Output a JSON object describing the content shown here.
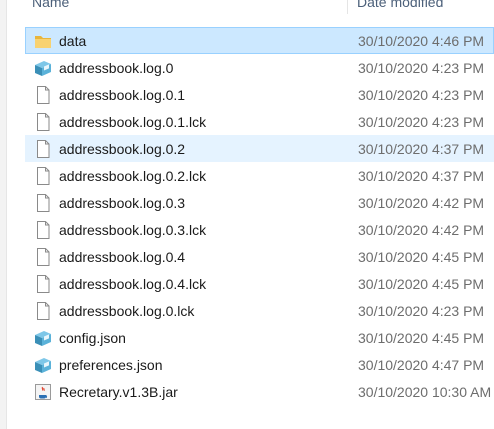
{
  "header": {
    "name_label": "Name",
    "date_label": "Date modified"
  },
  "files": [
    {
      "name": "data",
      "date": "30/10/2020 4:46 PM",
      "icon": "folder-icon",
      "state": "selected"
    },
    {
      "name": "addressbook.log.0",
      "date": "30/10/2020 4:23 PM",
      "icon": "app-file-icon",
      "state": ""
    },
    {
      "name": "addressbook.log.0.1",
      "date": "30/10/2020 4:23 PM",
      "icon": "blank-file-icon",
      "state": ""
    },
    {
      "name": "addressbook.log.0.1.lck",
      "date": "30/10/2020 4:23 PM",
      "icon": "blank-file-icon",
      "state": ""
    },
    {
      "name": "addressbook.log.0.2",
      "date": "30/10/2020 4:37 PM",
      "icon": "blank-file-icon",
      "state": "hover"
    },
    {
      "name": "addressbook.log.0.2.lck",
      "date": "30/10/2020 4:37 PM",
      "icon": "blank-file-icon",
      "state": ""
    },
    {
      "name": "addressbook.log.0.3",
      "date": "30/10/2020 4:42 PM",
      "icon": "blank-file-icon",
      "state": ""
    },
    {
      "name": "addressbook.log.0.3.lck",
      "date": "30/10/2020 4:42 PM",
      "icon": "blank-file-icon",
      "state": ""
    },
    {
      "name": "addressbook.log.0.4",
      "date": "30/10/2020 4:45 PM",
      "icon": "blank-file-icon",
      "state": ""
    },
    {
      "name": "addressbook.log.0.4.lck",
      "date": "30/10/2020 4:45 PM",
      "icon": "blank-file-icon",
      "state": ""
    },
    {
      "name": "addressbook.log.0.lck",
      "date": "30/10/2020 4:23 PM",
      "icon": "blank-file-icon",
      "state": ""
    },
    {
      "name": "config.json",
      "date": "30/10/2020 4:45 PM",
      "icon": "app-file-icon",
      "state": ""
    },
    {
      "name": "preferences.json",
      "date": "30/10/2020 4:47 PM",
      "icon": "app-file-icon",
      "state": ""
    },
    {
      "name": "Recretary.v1.3B.jar",
      "date": "30/10/2020 10:30 AM",
      "icon": "java-jar-icon",
      "state": ""
    }
  ],
  "colors": {
    "selected_bg": "#cce8ff",
    "selected_border": "#99d1ff",
    "hover_bg": "#e5f3ff",
    "header_text": "#4c607a",
    "date_text": "#6d6d6d"
  }
}
